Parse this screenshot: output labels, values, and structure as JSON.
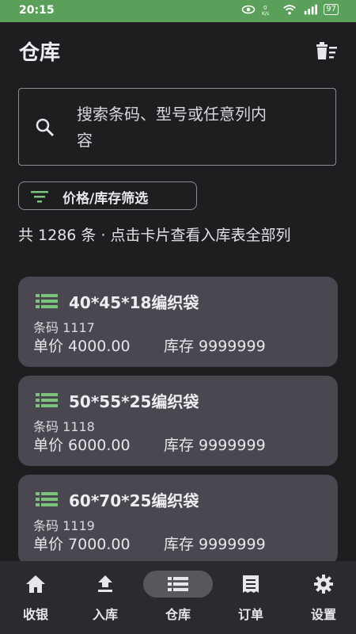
{
  "status_bar": {
    "time": "20:15",
    "battery": "97"
  },
  "header": {
    "title": "仓库"
  },
  "search": {
    "placeholder": "搜索条码、型号或任意列内容"
  },
  "filter": {
    "label": "价格/库存筛选"
  },
  "summary": {
    "text": "共 1286 条 · 点击卡片查看入库表全部列"
  },
  "cards": [
    {
      "title": "40*45*18编织袋",
      "barcode": "条码 1117",
      "price": "单价 4000.00",
      "stock": "库存 9999999"
    },
    {
      "title": "50*55*25编织袋",
      "barcode": "条码 1118",
      "price": "单价 6000.00",
      "stock": "库存 9999999"
    },
    {
      "title": "60*70*25编织袋",
      "barcode": "条码 1119",
      "price": "单价 7000.00",
      "stock": "库存 9999999"
    }
  ],
  "nav": [
    {
      "label": "收银",
      "icon": "home-icon"
    },
    {
      "label": "入库",
      "icon": "upload-icon"
    },
    {
      "label": "仓库",
      "icon": "list-icon",
      "active": true
    },
    {
      "label": "订单",
      "icon": "receipt-icon"
    },
    {
      "label": "设置",
      "icon": "gear-icon"
    }
  ],
  "colors": {
    "accent": "#5aa05a",
    "card_bg": "#4a4750",
    "page_bg": "#1e1d20"
  }
}
